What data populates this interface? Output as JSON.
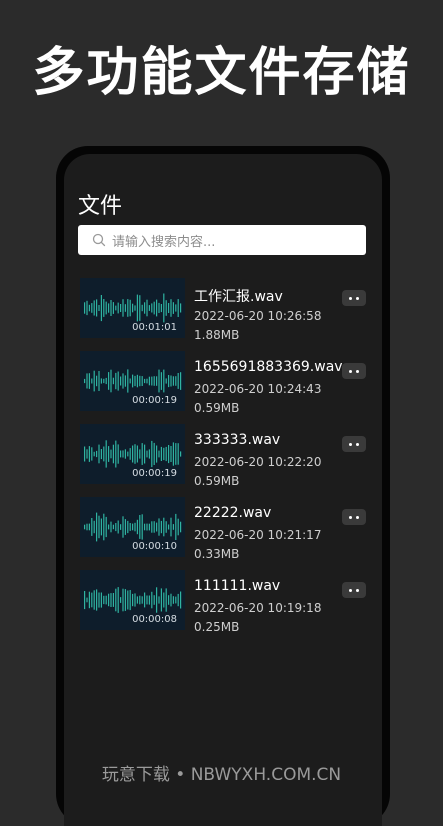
{
  "banner": {
    "text": "多功能文件存储"
  },
  "page": {
    "title": "文件"
  },
  "search": {
    "placeholder": "请输入搜索内容..."
  },
  "files": [
    {
      "name": "工作汇报.wav",
      "time": "2022-06-20 10:26:58",
      "size": "1.88MB",
      "duration": "00:01:01"
    },
    {
      "name": "1655691883369.wav",
      "time": "2022-06-20 10:24:43",
      "size": "0.59MB",
      "duration": "00:00:19"
    },
    {
      "name": "333333.wav",
      "time": "2022-06-20 10:22:20",
      "size": "0.59MB",
      "duration": "00:00:19"
    },
    {
      "name": "22222.wav",
      "time": "2022-06-20 10:21:17",
      "size": "0.33MB",
      "duration": "00:00:10"
    },
    {
      "name": "111111.wav",
      "time": "2022-06-20 10:19:18",
      "size": "0.25MB",
      "duration": "00:00:08"
    }
  ],
  "watermark": {
    "text": "玩意下载 • NBWYXH.COM.CN"
  },
  "colors": {
    "background": "#2b2b2b",
    "screen": "#1c1c1c",
    "thumbnail": "#0e1d2b",
    "waveform": "#2fb3a2",
    "more_button": "#3a3a3a"
  },
  "icons": {
    "search": "search-icon",
    "more": "more-dots-icon",
    "waveform": "waveform-icon"
  }
}
